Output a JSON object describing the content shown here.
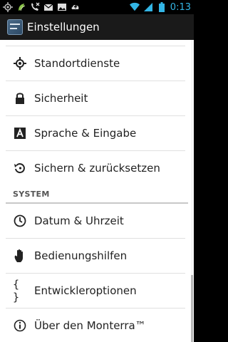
{
  "status_bar": {
    "time": "0:13",
    "left_icons": [
      "gps-icon",
      "swiftkey-icon",
      "phone-x-icon",
      "mail-icon",
      "image-icon",
      "upload-icon"
    ],
    "right_icons": [
      "wifi-icon",
      "signal-icon",
      "battery-icon"
    ]
  },
  "action_bar": {
    "title": "Einstellungen"
  },
  "items_top": [
    {
      "label": "Standortdienste",
      "icon": "location-icon"
    },
    {
      "label": "Sicherheit",
      "icon": "lock-icon"
    },
    {
      "label": "Sprache & Eingabe",
      "icon": "language-icon"
    },
    {
      "label": "Sichern & zurücksetzen",
      "icon": "backup-icon"
    }
  ],
  "section_system": {
    "title": "SYSTEM"
  },
  "items_system": [
    {
      "label": "Datum & Uhrzeit",
      "icon": "clock-icon"
    },
    {
      "label": "Bedienungshilfen",
      "icon": "hand-icon"
    },
    {
      "label": "Entwickleroptionen",
      "icon": "braces-icon",
      "glyph": "{ }"
    },
    {
      "label": "Über den Monterra™",
      "icon": "info-icon"
    }
  ],
  "colors": {
    "accent": "#33b5e5",
    "action_bar": "#1a1a1a",
    "content_bg": "#ffffff"
  }
}
